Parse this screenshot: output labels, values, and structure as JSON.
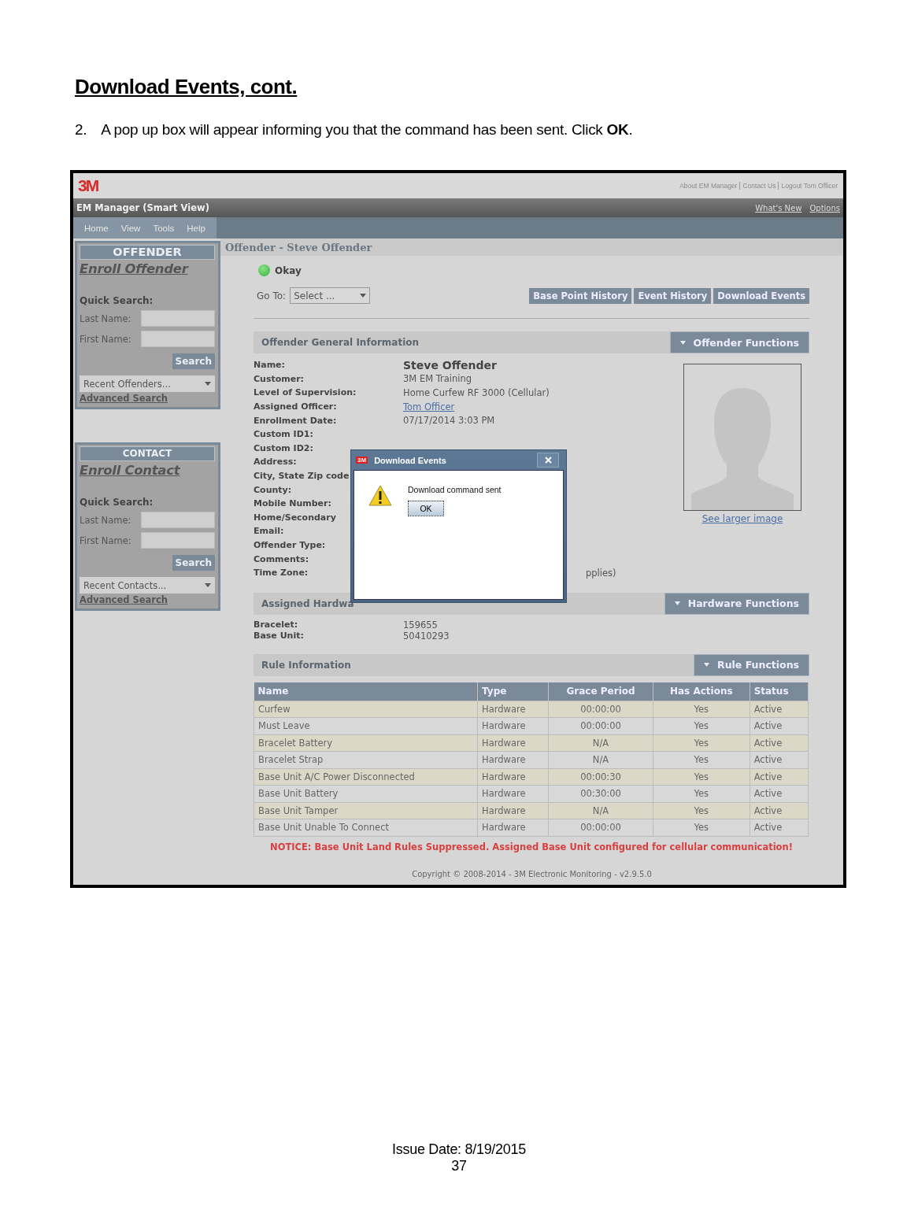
{
  "document": {
    "heading": "Download Events, cont.",
    "step_number": "2.",
    "step_text": "A pop up box will appear informing you that the command has been sent. Click **OK**.",
    "issue_date": "Issue Date: 8/19/2015",
    "page_number": "37"
  },
  "app": {
    "logo": "3M",
    "top_links": [
      "About EM Manager",
      "Contact Us",
      "Logout Tom Officer"
    ],
    "title": "EM Manager (Smart View)",
    "title_links": [
      "What's New",
      "Options"
    ],
    "menu": [
      "Home",
      "View",
      "Tools",
      "Help"
    ],
    "sidebar": [
      {
        "header": "OFFENDER",
        "enroll_link": "Enroll Offender",
        "quick_search": "Quick Search:",
        "fields": [
          {
            "label": "Last Name:"
          },
          {
            "label": "First Name:"
          }
        ],
        "search_button": "Search",
        "recent": "Recent Offenders...",
        "advanced_link": "Advanced Search"
      },
      {
        "header": "CONTACT",
        "enroll_link": "Enroll Contact",
        "quick_search": "Quick Search:",
        "fields": [
          {
            "label": "Last Name:"
          },
          {
            "label": "First Name:"
          }
        ],
        "search_button": "Search",
        "recent": "Recent Contacts...",
        "advanced_link": "Advanced Search"
      }
    ],
    "page_title": "Offender - Steve Offender",
    "status": "Okay",
    "goto": {
      "label": "Go To:",
      "value": "Select ..."
    },
    "actions": [
      "Base Point History",
      "Event History",
      "Download Events"
    ],
    "general": {
      "title": "Offender General Information",
      "functions": "Offender Functions",
      "photo_link": "See larger image",
      "fields": [
        {
          "label": "Name:",
          "value": "Steve Offender",
          "kind": "title"
        },
        {
          "label": "Customer:",
          "value": "3M EM Training",
          "kind": "text"
        },
        {
          "label": "Level of Supervision:",
          "value": "Home Curfew RF 3000 (Cellular)",
          "kind": "text"
        },
        {
          "label": "Assigned Officer:",
          "value": "Tom Officer",
          "kind": "link"
        },
        {
          "label": "Enrollment Date:",
          "value": "07/17/2014 3:03 PM",
          "kind": "text"
        },
        {
          "label": "Custom ID1:"
        },
        {
          "label": "Custom ID2:"
        },
        {
          "label": "Address:"
        },
        {
          "label": "City, State Zip code"
        },
        {
          "label": "County:"
        },
        {
          "label": "Mobile Number:"
        },
        {
          "label": "Home/Secondary"
        },
        {
          "label": "Email:"
        },
        {
          "label": "Offender Type:"
        },
        {
          "label": "Comments:"
        },
        {
          "label": "Time Zone:",
          "value": "pplies)",
          "kind": "behind"
        }
      ]
    },
    "hardware": {
      "title": "Assigned Hardwa",
      "functions": "Hardware Functions",
      "fields": [
        {
          "label": "Bracelet:",
          "value": "159655"
        },
        {
          "label": "Base Unit:",
          "value": "50410293"
        }
      ]
    },
    "rules": {
      "title": "Rule Information",
      "functions": "Rule Functions",
      "columns": [
        "Name",
        "Type",
        "Grace Period",
        "Has Actions",
        "Status"
      ],
      "rows": [
        [
          "Curfew",
          "Hardware",
          "00:00:00",
          "Yes",
          "Active"
        ],
        [
          "Must Leave",
          "Hardware",
          "00:00:00",
          "Yes",
          "Active"
        ],
        [
          "Bracelet Battery",
          "Hardware",
          "N/A",
          "Yes",
          "Active"
        ],
        [
          "Bracelet Strap",
          "Hardware",
          "N/A",
          "Yes",
          "Active"
        ],
        [
          "Base Unit A/C Power Disconnected",
          "Hardware",
          "00:00:30",
          "Yes",
          "Active"
        ],
        [
          "Base Unit Battery",
          "Hardware",
          "00:30:00",
          "Yes",
          "Active"
        ],
        [
          "Base Unit Tamper",
          "Hardware",
          "N/A",
          "Yes",
          "Active"
        ],
        [
          "Base Unit Unable To Connect",
          "Hardware",
          "00:00:00",
          "Yes",
          "Active"
        ]
      ],
      "notice": "NOTICE: Base Unit Land Rules Suppressed. Assigned Base Unit configured for cellular communication!"
    },
    "dialog": {
      "logo": "3M",
      "title": "Download Events",
      "message": "Download command sent",
      "button": "OK"
    },
    "copyright": "Copyright © 2008-2014 - 3M Electronic Monitoring - v2.9.5.0"
  }
}
